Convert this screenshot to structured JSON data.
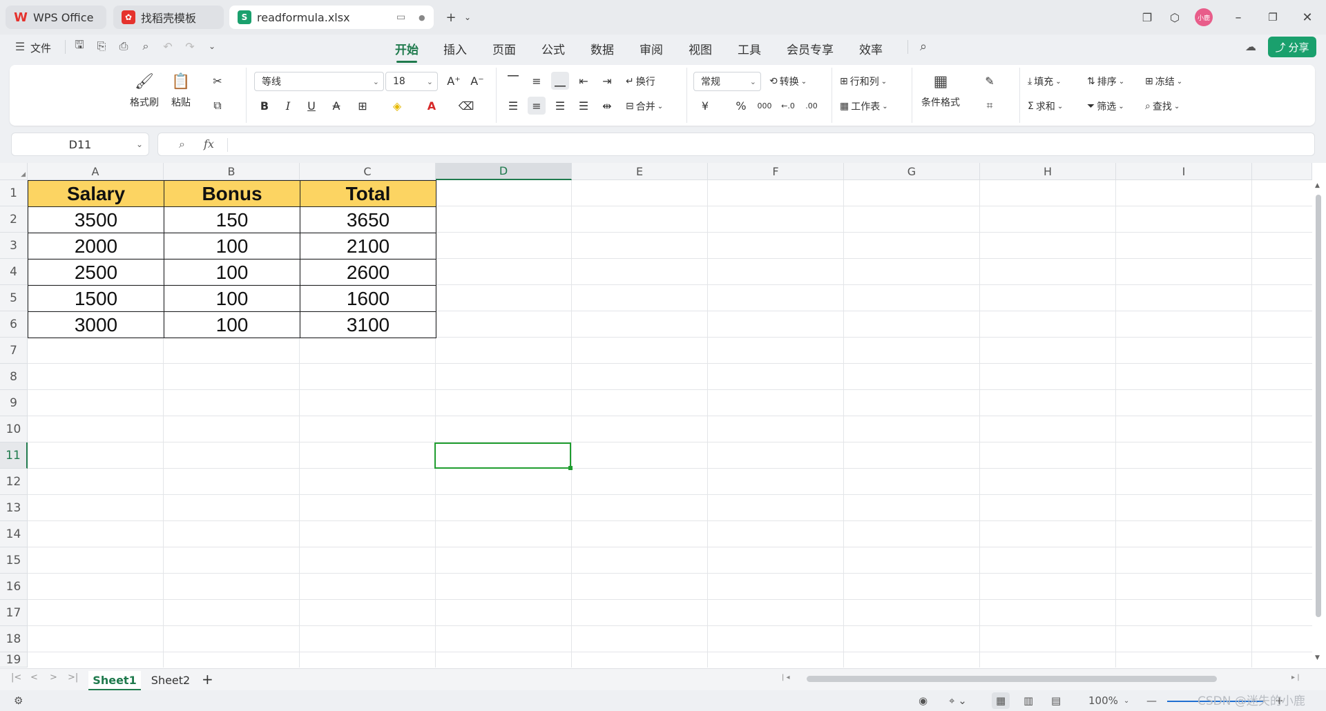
{
  "tabs": [
    {
      "label": "WPS Office",
      "icon": "wps-logo-icon",
      "color": "#e5322d"
    },
    {
      "label": "找稻壳模板",
      "icon": "docer-template-icon",
      "color": "#e5322d"
    },
    {
      "label": "readformula.xlsx",
      "icon": "spreadsheet-s-icon",
      "color": "#1aa06d"
    }
  ],
  "menu": {
    "file": "文件",
    "items": [
      "开始",
      "插入",
      "页面",
      "公式",
      "数据",
      "审阅",
      "视图",
      "工具",
      "会员专享",
      "效率"
    ],
    "active": "开始",
    "share": "分享"
  },
  "avatar_text": "小鹿",
  "ribbon": {
    "format_painter": "格式刷",
    "paste": "粘贴",
    "font_name": "等线",
    "font_size": "18",
    "wrap": "换行",
    "merge": "合并",
    "number_format": "常规",
    "convert": "转换",
    "rows_cols": "行和列",
    "worksheet": "工作表",
    "cond_format": "条件格式",
    "fill": "填充",
    "sort": "排序",
    "freeze": "冻结",
    "sum": "求和",
    "filter": "筛选",
    "find": "查找",
    "bold": "B",
    "italic": "I",
    "underline": "U",
    "strike": "A",
    "currency": "¥",
    "percent": "%",
    "thousands": "000",
    "inc_dec": "←.0",
    "dec_dec": ".00"
  },
  "formula_bar": {
    "cell_ref": "D11",
    "fx": "fx",
    "content": ""
  },
  "columns": [
    "A",
    "B",
    "C",
    "D",
    "E",
    "F",
    "G",
    "H",
    "I"
  ],
  "selected_column": "D",
  "rows": [
    "1",
    "2",
    "3",
    "4",
    "5",
    "6",
    "7",
    "8",
    "9",
    "10",
    "11",
    "12",
    "13",
    "14",
    "15",
    "16",
    "17",
    "18",
    "19"
  ],
  "selected_row": "11",
  "table": {
    "headers": [
      "Salary",
      "Bonus",
      "Total"
    ],
    "data": [
      [
        "3500",
        "150",
        "3650"
      ],
      [
        "2000",
        "100",
        "2100"
      ],
      [
        "2500",
        "100",
        "2600"
      ],
      [
        "1500",
        "100",
        "1600"
      ],
      [
        "3000",
        "100",
        "3100"
      ]
    ]
  },
  "sheets": [
    "Sheet1",
    "Sheet2"
  ],
  "active_sheet": "Sheet1",
  "status": {
    "zoom": "100%"
  },
  "watermark": "CSDN @迷失的小鹿",
  "colors": {
    "accent": "#1f7a4d",
    "header_fill": "#fcd462",
    "selection": "#1f9d2f",
    "share": "#1aa06d"
  }
}
